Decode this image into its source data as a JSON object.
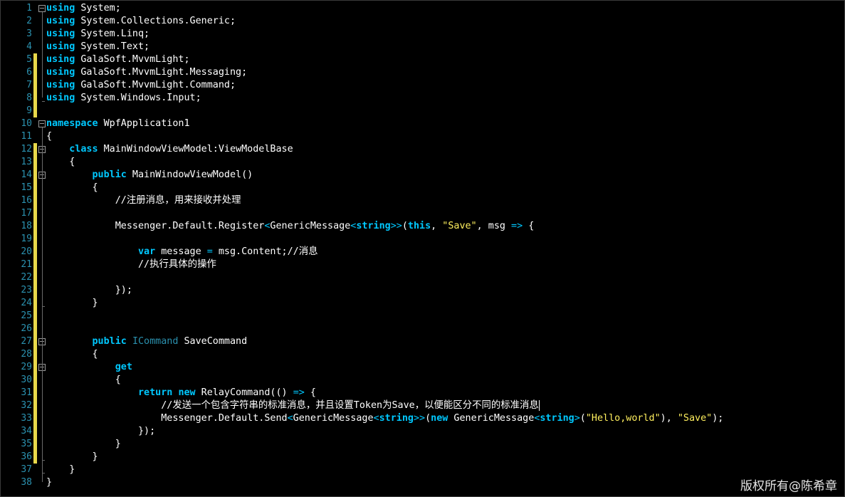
{
  "editor": {
    "line_numbers": [
      "1",
      "2",
      "3",
      "4",
      "5",
      "6",
      "7",
      "8",
      "9",
      "10",
      "11",
      "12",
      "13",
      "14",
      "15",
      "16",
      "17",
      "18",
      "19",
      "20",
      "21",
      "22",
      "23",
      "24",
      "25",
      "26",
      "27",
      "28",
      "29",
      "30",
      "31",
      "32",
      "33",
      "34",
      "35",
      "36",
      "37",
      "38"
    ],
    "lines": [
      [
        {
          "t": "using",
          "c": "kw"
        },
        {
          "t": " System;"
        }
      ],
      [
        {
          "t": "using",
          "c": "kw"
        },
        {
          "t": " System.Collections.Generic;"
        }
      ],
      [
        {
          "t": "using",
          "c": "kw"
        },
        {
          "t": " System.Linq;"
        }
      ],
      [
        {
          "t": "using",
          "c": "kw"
        },
        {
          "t": " System.Text;"
        }
      ],
      [
        {
          "t": "using",
          "c": "kw"
        },
        {
          "t": " GalaSoft.MvvmLight;"
        }
      ],
      [
        {
          "t": "using",
          "c": "kw"
        },
        {
          "t": " GalaSoft.MvvmLight.Messaging;"
        }
      ],
      [
        {
          "t": "using",
          "c": "kw"
        },
        {
          "t": " GalaSoft.MvvmLight.Command;"
        }
      ],
      [
        {
          "t": "using",
          "c": "kw"
        },
        {
          "t": " System.Windows.Input;"
        }
      ],
      [],
      [
        {
          "t": "namespace",
          "c": "kw"
        },
        {
          "t": " WpfApplication1"
        }
      ],
      [
        {
          "t": "{"
        }
      ],
      [
        {
          "t": "    "
        },
        {
          "t": "class",
          "c": "kw"
        },
        {
          "t": " MainWindowViewModel:ViewModelBase"
        }
      ],
      [
        {
          "t": "    {"
        }
      ],
      [
        {
          "t": "        "
        },
        {
          "t": "public",
          "c": "kw"
        },
        {
          "t": " MainWindowViewModel()"
        }
      ],
      [
        {
          "t": "        {"
        }
      ],
      [
        {
          "t": "            //注册消息，用来接收并处理",
          "c": "cm"
        }
      ],
      [],
      [
        {
          "t": "            Messenger.Default.Register"
        },
        {
          "t": "<",
          "c": "op"
        },
        {
          "t": "GenericMessage"
        },
        {
          "t": "<",
          "c": "op"
        },
        {
          "t": "string",
          "c": "kw"
        },
        {
          "t": ">>",
          "c": "op"
        },
        {
          "t": "("
        },
        {
          "t": "this",
          "c": "kw"
        },
        {
          "t": ", "
        },
        {
          "t": "\"Save\"",
          "c": "str"
        },
        {
          "t": ", msg "
        },
        {
          "t": "=>",
          "c": "op"
        },
        {
          "t": " {"
        }
      ],
      [],
      [
        {
          "t": "                "
        },
        {
          "t": "var",
          "c": "kw"
        },
        {
          "t": " message "
        },
        {
          "t": "=",
          "c": "op"
        },
        {
          "t": " msg.Content;//消息"
        }
      ],
      [
        {
          "t": "                //执行具体的操作",
          "c": "cm"
        }
      ],
      [],
      [
        {
          "t": "            });"
        }
      ],
      [
        {
          "t": "        }"
        }
      ],
      [],
      [],
      [
        {
          "t": "        "
        },
        {
          "t": "public",
          "c": "kw"
        },
        {
          "t": " "
        },
        {
          "t": "ICommand",
          "c": "ty"
        },
        {
          "t": " SaveCommand"
        }
      ],
      [
        {
          "t": "        {"
        }
      ],
      [
        {
          "t": "            "
        },
        {
          "t": "get",
          "c": "kw"
        }
      ],
      [
        {
          "t": "            {"
        }
      ],
      [
        {
          "t": "                "
        },
        {
          "t": "return",
          "c": "kw"
        },
        {
          "t": " "
        },
        {
          "t": "new",
          "c": "kw"
        },
        {
          "t": " RelayCommand(() "
        },
        {
          "t": "=>",
          "c": "op"
        },
        {
          "t": " {"
        }
      ],
      [
        {
          "t": "                    //发送一个包含字符串的标准消息，并且设置Token为Save，以便能区分不同的标准消息",
          "c": "cm"
        }
      ],
      [
        {
          "t": "                    Messenger.Default.Send"
        },
        {
          "t": "<",
          "c": "op"
        },
        {
          "t": "GenericMessage"
        },
        {
          "t": "<",
          "c": "op"
        },
        {
          "t": "string",
          "c": "kw"
        },
        {
          "t": ">>",
          "c": "op"
        },
        {
          "t": "("
        },
        {
          "t": "new",
          "c": "kw"
        },
        {
          "t": " GenericMessage"
        },
        {
          "t": "<",
          "c": "op"
        },
        {
          "t": "string",
          "c": "kw"
        },
        {
          "t": ">",
          "c": "op"
        },
        {
          "t": "("
        },
        {
          "t": "\"Hello,world\"",
          "c": "str"
        },
        {
          "t": "), "
        },
        {
          "t": "\"Save\"",
          "c": "str"
        },
        {
          "t": ");"
        }
      ],
      [
        {
          "t": "                });"
        }
      ],
      [
        {
          "t": "            }"
        }
      ],
      [
        {
          "t": "        }"
        }
      ],
      [
        {
          "t": "    }"
        }
      ],
      [
        {
          "t": "}"
        }
      ]
    ],
    "changed_lines": [
      5,
      6,
      7,
      8,
      9,
      12,
      13,
      14,
      15,
      16,
      17,
      18,
      19,
      20,
      21,
      22,
      23,
      24,
      25,
      26,
      27,
      28,
      29,
      30,
      31,
      32,
      33,
      34,
      35,
      36
    ],
    "fold_lines": [
      1,
      10,
      12,
      14,
      27,
      29
    ],
    "caret_line": 32
  },
  "watermark": "版权所有@陈希章",
  "colors": {
    "background": "#000000",
    "keyword": "#00c8ff",
    "type": "#2b91af",
    "string": "#ffef5e",
    "line_number": "#2b91af",
    "change_marker": "#e8d84a"
  }
}
